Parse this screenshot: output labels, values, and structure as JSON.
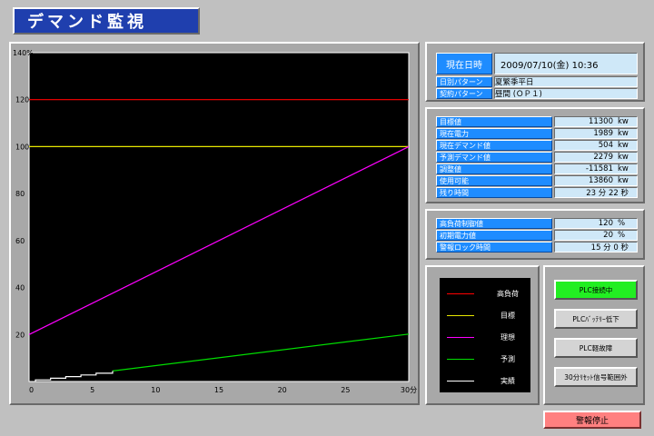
{
  "app": {
    "title": "デマンド監視"
  },
  "datetime_panel": {
    "label": "現在日時",
    "value": "2009/07/10(金) 10:36",
    "day_pattern_label": "日別パターン",
    "day_pattern_value": "夏繁季平日",
    "contract_pattern_label": "契約パターン",
    "contract_pattern_value": "昼間 (ＯＰ１)"
  },
  "demand_panel": {
    "rows": [
      {
        "label": "目標値",
        "value": "11300",
        "unit": "kw"
      },
      {
        "label": "現在電力",
        "value": "1989",
        "unit": "kw"
      },
      {
        "label": "現在デマンド値",
        "value": "504",
        "unit": "kw"
      },
      {
        "label": "予測デマンド値",
        "value": "2279",
        "unit": "kw"
      },
      {
        "label": "調整値",
        "value": "-11581",
        "unit": "kw"
      },
      {
        "label": "使用可能",
        "value": "13860",
        "unit": "kw"
      },
      {
        "label": "残り時間",
        "value": "23 分 22 秒",
        "unit": ""
      }
    ]
  },
  "settings_panel": {
    "rows": [
      {
        "label": "高負荷制御値",
        "value": "120",
        "unit": "%"
      },
      {
        "label": "初期電力値",
        "value": "20",
        "unit": "%"
      },
      {
        "label": "警報ロック時間",
        "value": "15 分  0 秒",
        "unit": ""
      }
    ]
  },
  "legend": {
    "items": [
      {
        "label": "高負荷",
        "color": "#ff0000"
      },
      {
        "label": "目標",
        "color": "#e8e800"
      },
      {
        "label": "理想",
        "color": "#ff00ff"
      },
      {
        "label": "予測",
        "color": "#00e000"
      },
      {
        "label": "実績",
        "color": "#ffffff"
      }
    ]
  },
  "status_buttons": {
    "plc_connected": "PLC接続中",
    "plc_battery_low": "PLCﾊﾞｯﾃﾘｰ低下",
    "plc_minor_fault": "PLC軽故障",
    "reset_signal_out_of_range": "30分ﾘｾｯﾄ信号範囲外"
  },
  "alarm_stop_button": "警報停止",
  "chart_data": {
    "type": "line",
    "xlim": [
      0,
      30
    ],
    "ylim": [
      0,
      140
    ],
    "x_ticks": [
      "0",
      "5",
      "10",
      "15",
      "20",
      "25",
      "30分"
    ],
    "y_ticks": [
      "20",
      "40",
      "60",
      "80",
      "100",
      "120",
      "140%"
    ],
    "series": [
      {
        "name": "高負荷",
        "color": "#ff0000",
        "points": [
          [
            0,
            120
          ],
          [
            30,
            120
          ]
        ]
      },
      {
        "name": "目標",
        "color": "#e8e800",
        "points": [
          [
            0,
            100
          ],
          [
            30,
            100
          ]
        ]
      },
      {
        "name": "理想",
        "color": "#ff00ff",
        "points": [
          [
            0,
            20
          ],
          [
            30,
            100
          ]
        ]
      },
      {
        "name": "予測",
        "color": "#00e000",
        "points": [
          [
            6.6,
            4.5
          ],
          [
            30,
            20.2
          ]
        ]
      },
      {
        "name": "実績",
        "color": "#ffffff",
        "points": [
          [
            0.5,
            0
          ],
          [
            0.5,
            0.7
          ],
          [
            1.7,
            0.7
          ],
          [
            1.7,
            1.4
          ],
          [
            2.9,
            1.4
          ],
          [
            2.9,
            2.1
          ],
          [
            4.1,
            2.1
          ],
          [
            4.1,
            2.8
          ],
          [
            5.3,
            2.8
          ],
          [
            5.3,
            3.5
          ],
          [
            6.6,
            3.5
          ],
          [
            6.6,
            4.5
          ]
        ]
      }
    ],
    "grid": false
  }
}
